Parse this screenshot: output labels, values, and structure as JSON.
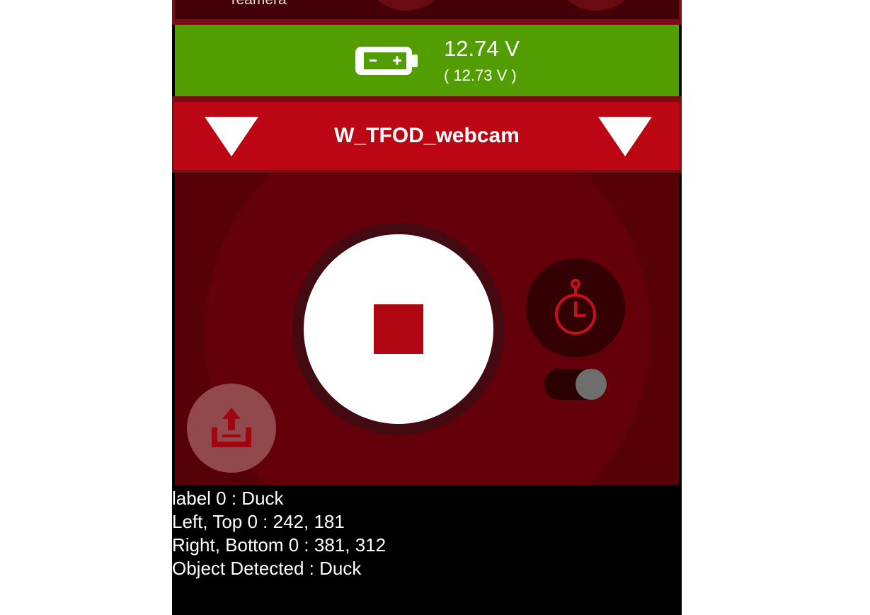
{
  "top_strip": {
    "label": "Teamera"
  },
  "battery": {
    "icon": "battery-icon",
    "voltage": "12.74 V",
    "voltage_secondary": "( 12.73 V )",
    "color": "#519d02"
  },
  "opmode": {
    "name": "W_TFOD_webcam",
    "left_arrow_icon": "triangle-down-icon",
    "right_arrow_icon": "triangle-down-icon",
    "color": "#bd0613"
  },
  "controls": {
    "start_stop_icon": "stop-icon",
    "timer_icon": "stopwatch-icon",
    "upload_icon": "upload-icon",
    "timer_enabled": true
  },
  "telemetry": [
    "label 0 : Duck",
    "Left, Top 0 : 242, 181",
    "Right, Bottom 0 : 381, 312",
    "Object Detected : Duck"
  ]
}
